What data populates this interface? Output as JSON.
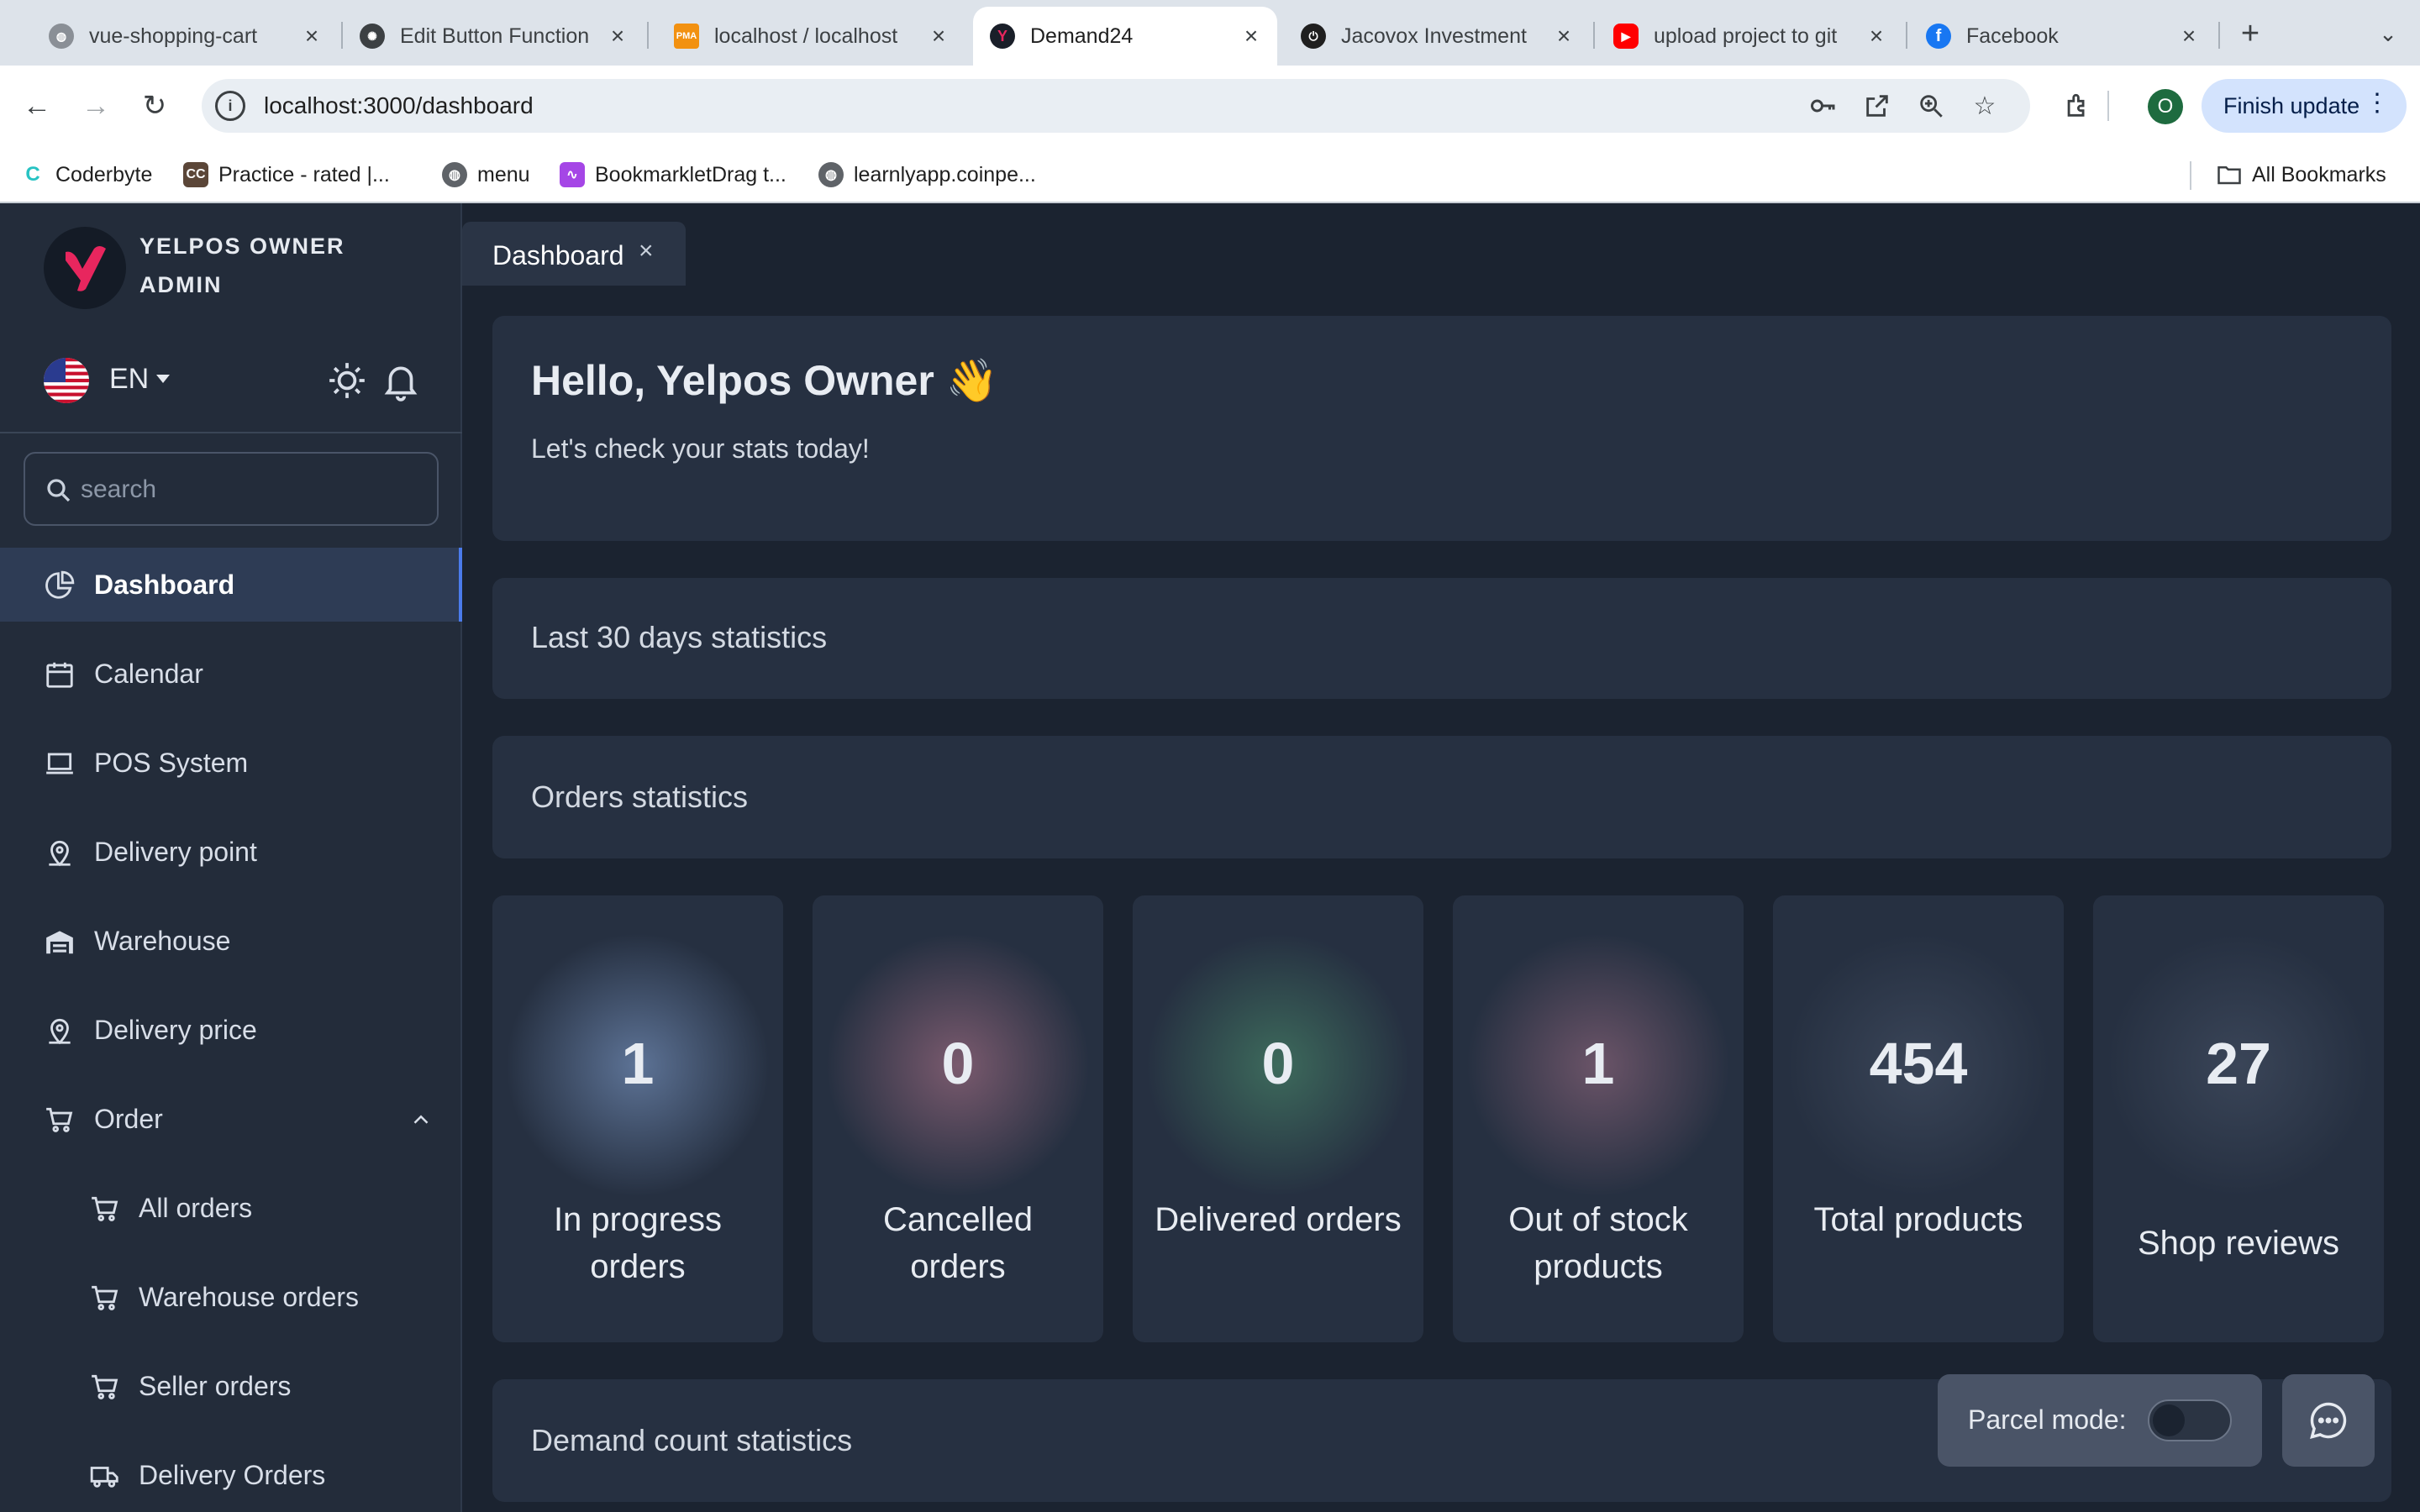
{
  "browser": {
    "tabs": [
      {
        "title": "vue-shopping-cart",
        "favicon": "globe-icon"
      },
      {
        "title": "Edit Button Function",
        "favicon": "openai-icon"
      },
      {
        "title": "localhost / localhost",
        "favicon": "phpmyadmin-icon"
      },
      {
        "title": "Demand24",
        "favicon": "yelpos-icon",
        "active": true
      },
      {
        "title": "Jacovox Investment",
        "favicon": "power-icon"
      },
      {
        "title": "upload project to git",
        "favicon": "youtube-icon"
      },
      {
        "title": "Facebook",
        "favicon": "facebook-icon"
      }
    ],
    "url": "localhost:3000/dashboard",
    "profile_initial": "O",
    "finish_update_label": "Finish update",
    "bookmarks": [
      {
        "label": "Coderbyte"
      },
      {
        "label": "Practice - rated |..."
      },
      {
        "label": "menu"
      },
      {
        "label": "BookmarkletDrag t..."
      },
      {
        "label": "learnlyapp.coinpe..."
      }
    ],
    "all_bookmarks_label": "All Bookmarks",
    "pma_favicon_text": "PMA"
  },
  "sidebar": {
    "brand_name": "YELPOS OWNER",
    "brand_role": "ADMIN",
    "language": "EN",
    "search_placeholder": "search",
    "items": [
      {
        "label": "Dashboard",
        "icon": "pie-chart-icon",
        "active": true
      },
      {
        "label": "Calendar",
        "icon": "calendar-icon"
      },
      {
        "label": "POS System",
        "icon": "laptop-icon"
      },
      {
        "label": "Delivery point",
        "icon": "map-pin-icon"
      },
      {
        "label": "Warehouse",
        "icon": "warehouse-icon"
      },
      {
        "label": "Delivery price",
        "icon": "map-pin-icon"
      },
      {
        "label": "Order",
        "icon": "cart-icon",
        "expanded": true
      }
    ],
    "sub_items": [
      {
        "label": "All orders",
        "icon": "cart-icon"
      },
      {
        "label": "Warehouse orders",
        "icon": "cart-icon"
      },
      {
        "label": "Seller orders",
        "icon": "cart-icon"
      },
      {
        "label": "Delivery Orders",
        "icon": "truck-icon"
      }
    ]
  },
  "main": {
    "page_tab": "Dashboard",
    "greeting": "Hello, Yelpos Owner 👋",
    "greeting_sub": "Let's check your stats today!",
    "last30_title": "Last 30 days statistics",
    "orders_title": "Orders statistics",
    "stats": [
      {
        "value": "1",
        "label": "In progress orders",
        "glow": "#5d7396"
      },
      {
        "value": "0",
        "label": "Cancelled orders",
        "glow": "#7a5a6e"
      },
      {
        "value": "0",
        "label": "Delivered orders",
        "glow": "#3d6a5c"
      },
      {
        "value": "1",
        "label": "Out of stock products",
        "glow": "#6b5468"
      },
      {
        "value": "454",
        "label": "Total products",
        "glow": "#3a4558"
      },
      {
        "value": "27",
        "label": "Shop reviews",
        "glow": "#3a4558"
      }
    ],
    "demand_title": "Demand count statistics",
    "parcel_mode_label": "Parcel mode:"
  },
  "colors": {
    "accent": "#4b7bec",
    "brand": "#e8265e",
    "background": "#1b2330",
    "card": "#263041"
  }
}
